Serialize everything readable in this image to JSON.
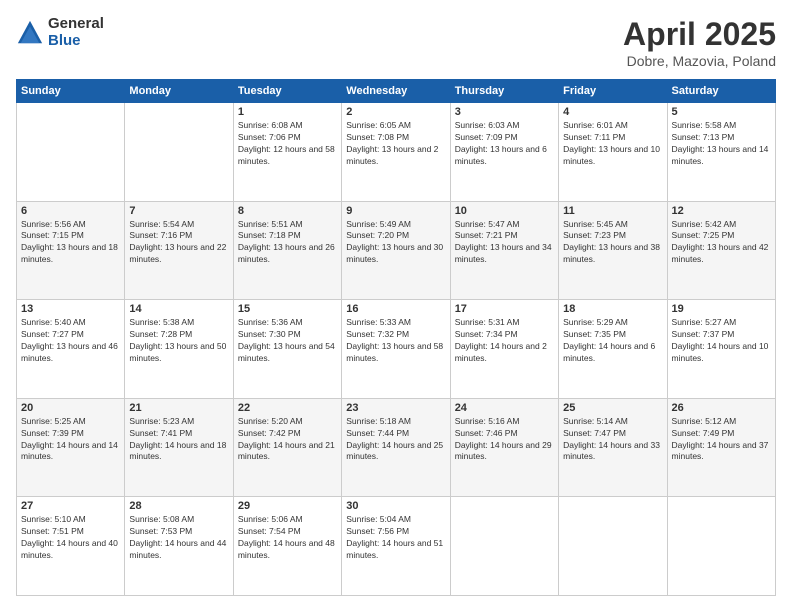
{
  "logo": {
    "general": "General",
    "blue": "Blue"
  },
  "title": {
    "month": "April 2025",
    "location": "Dobre, Mazovia, Poland"
  },
  "weekdays": [
    "Sunday",
    "Monday",
    "Tuesday",
    "Wednesday",
    "Thursday",
    "Friday",
    "Saturday"
  ],
  "weeks": [
    [
      {
        "day": null
      },
      {
        "day": null
      },
      {
        "day": "1",
        "sunrise": "Sunrise: 6:08 AM",
        "sunset": "Sunset: 7:06 PM",
        "daylight": "Daylight: 12 hours and 58 minutes."
      },
      {
        "day": "2",
        "sunrise": "Sunrise: 6:05 AM",
        "sunset": "Sunset: 7:08 PM",
        "daylight": "Daylight: 13 hours and 2 minutes."
      },
      {
        "day": "3",
        "sunrise": "Sunrise: 6:03 AM",
        "sunset": "Sunset: 7:09 PM",
        "daylight": "Daylight: 13 hours and 6 minutes."
      },
      {
        "day": "4",
        "sunrise": "Sunrise: 6:01 AM",
        "sunset": "Sunset: 7:11 PM",
        "daylight": "Daylight: 13 hours and 10 minutes."
      },
      {
        "day": "5",
        "sunrise": "Sunrise: 5:58 AM",
        "sunset": "Sunset: 7:13 PM",
        "daylight": "Daylight: 13 hours and 14 minutes."
      }
    ],
    [
      {
        "day": "6",
        "sunrise": "Sunrise: 5:56 AM",
        "sunset": "Sunset: 7:15 PM",
        "daylight": "Daylight: 13 hours and 18 minutes."
      },
      {
        "day": "7",
        "sunrise": "Sunrise: 5:54 AM",
        "sunset": "Sunset: 7:16 PM",
        "daylight": "Daylight: 13 hours and 22 minutes."
      },
      {
        "day": "8",
        "sunrise": "Sunrise: 5:51 AM",
        "sunset": "Sunset: 7:18 PM",
        "daylight": "Daylight: 13 hours and 26 minutes."
      },
      {
        "day": "9",
        "sunrise": "Sunrise: 5:49 AM",
        "sunset": "Sunset: 7:20 PM",
        "daylight": "Daylight: 13 hours and 30 minutes."
      },
      {
        "day": "10",
        "sunrise": "Sunrise: 5:47 AM",
        "sunset": "Sunset: 7:21 PM",
        "daylight": "Daylight: 13 hours and 34 minutes."
      },
      {
        "day": "11",
        "sunrise": "Sunrise: 5:45 AM",
        "sunset": "Sunset: 7:23 PM",
        "daylight": "Daylight: 13 hours and 38 minutes."
      },
      {
        "day": "12",
        "sunrise": "Sunrise: 5:42 AM",
        "sunset": "Sunset: 7:25 PM",
        "daylight": "Daylight: 13 hours and 42 minutes."
      }
    ],
    [
      {
        "day": "13",
        "sunrise": "Sunrise: 5:40 AM",
        "sunset": "Sunset: 7:27 PM",
        "daylight": "Daylight: 13 hours and 46 minutes."
      },
      {
        "day": "14",
        "sunrise": "Sunrise: 5:38 AM",
        "sunset": "Sunset: 7:28 PM",
        "daylight": "Daylight: 13 hours and 50 minutes."
      },
      {
        "day": "15",
        "sunrise": "Sunrise: 5:36 AM",
        "sunset": "Sunset: 7:30 PM",
        "daylight": "Daylight: 13 hours and 54 minutes."
      },
      {
        "day": "16",
        "sunrise": "Sunrise: 5:33 AM",
        "sunset": "Sunset: 7:32 PM",
        "daylight": "Daylight: 13 hours and 58 minutes."
      },
      {
        "day": "17",
        "sunrise": "Sunrise: 5:31 AM",
        "sunset": "Sunset: 7:34 PM",
        "daylight": "Daylight: 14 hours and 2 minutes."
      },
      {
        "day": "18",
        "sunrise": "Sunrise: 5:29 AM",
        "sunset": "Sunset: 7:35 PM",
        "daylight": "Daylight: 14 hours and 6 minutes."
      },
      {
        "day": "19",
        "sunrise": "Sunrise: 5:27 AM",
        "sunset": "Sunset: 7:37 PM",
        "daylight": "Daylight: 14 hours and 10 minutes."
      }
    ],
    [
      {
        "day": "20",
        "sunrise": "Sunrise: 5:25 AM",
        "sunset": "Sunset: 7:39 PM",
        "daylight": "Daylight: 14 hours and 14 minutes."
      },
      {
        "day": "21",
        "sunrise": "Sunrise: 5:23 AM",
        "sunset": "Sunset: 7:41 PM",
        "daylight": "Daylight: 14 hours and 18 minutes."
      },
      {
        "day": "22",
        "sunrise": "Sunrise: 5:20 AM",
        "sunset": "Sunset: 7:42 PM",
        "daylight": "Daylight: 14 hours and 21 minutes."
      },
      {
        "day": "23",
        "sunrise": "Sunrise: 5:18 AM",
        "sunset": "Sunset: 7:44 PM",
        "daylight": "Daylight: 14 hours and 25 minutes."
      },
      {
        "day": "24",
        "sunrise": "Sunrise: 5:16 AM",
        "sunset": "Sunset: 7:46 PM",
        "daylight": "Daylight: 14 hours and 29 minutes."
      },
      {
        "day": "25",
        "sunrise": "Sunrise: 5:14 AM",
        "sunset": "Sunset: 7:47 PM",
        "daylight": "Daylight: 14 hours and 33 minutes."
      },
      {
        "day": "26",
        "sunrise": "Sunrise: 5:12 AM",
        "sunset": "Sunset: 7:49 PM",
        "daylight": "Daylight: 14 hours and 37 minutes."
      }
    ],
    [
      {
        "day": "27",
        "sunrise": "Sunrise: 5:10 AM",
        "sunset": "Sunset: 7:51 PM",
        "daylight": "Daylight: 14 hours and 40 minutes."
      },
      {
        "day": "28",
        "sunrise": "Sunrise: 5:08 AM",
        "sunset": "Sunset: 7:53 PM",
        "daylight": "Daylight: 14 hours and 44 minutes."
      },
      {
        "day": "29",
        "sunrise": "Sunrise: 5:06 AM",
        "sunset": "Sunset: 7:54 PM",
        "daylight": "Daylight: 14 hours and 48 minutes."
      },
      {
        "day": "30",
        "sunrise": "Sunrise: 5:04 AM",
        "sunset": "Sunset: 7:56 PM",
        "daylight": "Daylight: 14 hours and 51 minutes."
      },
      {
        "day": null
      },
      {
        "day": null
      },
      {
        "day": null
      }
    ]
  ]
}
